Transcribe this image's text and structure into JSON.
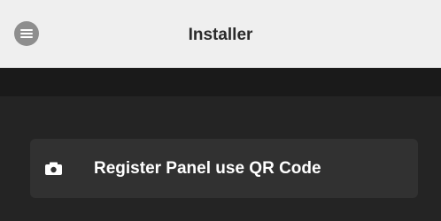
{
  "header": {
    "title": "Installer",
    "menu_icon": "hamburger-menu-icon"
  },
  "actions": {
    "register_qr": {
      "label": "Register Panel use QR Code",
      "icon": "camera-icon"
    }
  },
  "colors": {
    "header_bg": "#efefef",
    "page_bg": "#242424",
    "button_bg": "#313131",
    "menu_icon_bg": "#8e8e8e"
  }
}
